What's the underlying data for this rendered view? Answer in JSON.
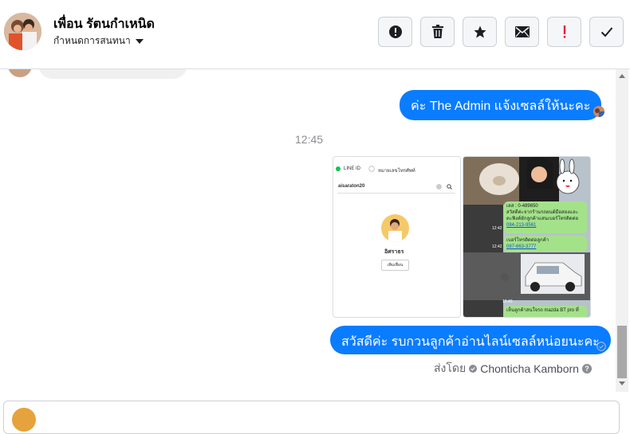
{
  "header": {
    "contact_name": "เพื่อน รัตนกำเหนิด",
    "subtitle": "กำหนดการสนทนา",
    "tools": [
      {
        "icon": "alert-circle-icon",
        "name": "alert-button"
      },
      {
        "icon": "trash-icon",
        "name": "delete-button"
      },
      {
        "icon": "star-icon",
        "name": "star-button"
      },
      {
        "icon": "mail-icon",
        "name": "mail-button"
      },
      {
        "icon": "exclamation-icon",
        "name": "important-button"
      },
      {
        "icon": "check-icon",
        "name": "done-button"
      }
    ]
  },
  "messages": {
    "first_out": "ค่ะ The Admin แจ้งเซลล์ให้นะคะ",
    "timestamp": "12:45",
    "second_out": "สวัสดีค่ะ รบกวนลูกค้าอ่านไลน์เซลล์หน่อยนะคะ",
    "sent_by_label": "ส่งโดย",
    "sent_by_name": "Chonticha Kamborn",
    "help_glyph": "?"
  },
  "line_screenshot": {
    "tab_line_id": "LINE ID",
    "tab_phone": "หมายเลขโทรศัพท์",
    "search_value": "aisaraton20",
    "profile_name": "อิศราธร",
    "add_button": "เพิ่มเพื่อน"
  },
  "chat_screenshot": {
    "lines": [
      "เลส : 0-489650",
      "สวัสดีค่ะจากร้านรถยนต์มือสองและ",
      "ตะฟิงค์ยักลูกค้าแสนเบอร์โทรติดต่อ",
      "084-213-9561",
      "เบอร์โทรติดต่อลูกค้า",
      "087-663-3777",
      "เห็นลูกค้าสนใจรถ mazda BT pro ที่"
    ],
    "times": [
      "12:42",
      "12:42",
      "12:43"
    ]
  },
  "colors": {
    "accent": "#0a7cff",
    "border": "#ccd0d5",
    "muted": "#65676b",
    "line_green": "#a4e28a"
  }
}
